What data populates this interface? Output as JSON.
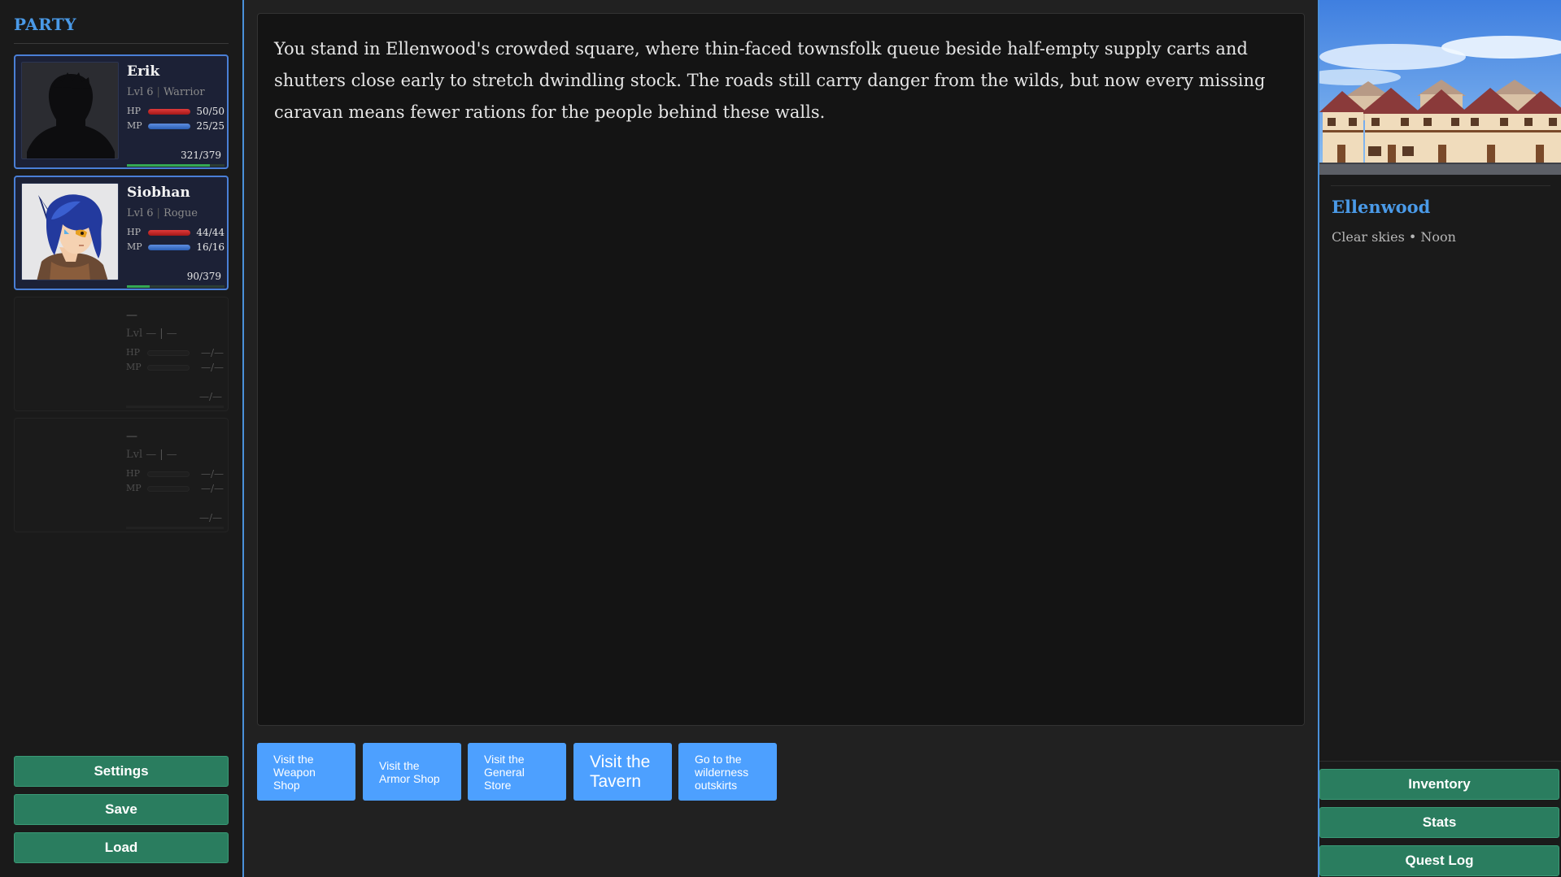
{
  "party": {
    "title": "PARTY",
    "members": [
      {
        "name": "Erik",
        "level": "Lvl 6",
        "class": "Warrior",
        "hp_label": "HP",
        "hp": "50/50",
        "hp_frac": 1.0,
        "mp_label": "MP",
        "mp": "25/25",
        "mp_frac": 1.0,
        "xp": "321/379",
        "xp_frac": 0.847
      },
      {
        "name": "Siobhan",
        "level": "Lvl 6",
        "class": "Rogue",
        "hp_label": "HP",
        "hp": "44/44",
        "hp_frac": 1.0,
        "mp_label": "MP",
        "mp": "16/16",
        "mp_frac": 1.0,
        "xp": "90/379",
        "xp_frac": 0.237
      },
      {
        "name": "—",
        "level": "Lvl —",
        "class": "—",
        "hp_label": "HP",
        "hp": "—/—",
        "hp_frac": 0,
        "mp_label": "MP",
        "mp": "—/—",
        "mp_frac": 0,
        "xp": "—/—",
        "xp_frac": 0
      },
      {
        "name": "—",
        "level": "Lvl —",
        "class": "—",
        "hp_label": "HP",
        "hp": "—/—",
        "hp_frac": 0,
        "mp_label": "MP",
        "mp": "—/—",
        "mp_frac": 0,
        "xp": "—/—",
        "xp_frac": 0
      }
    ]
  },
  "left_buttons": {
    "settings": "Settings",
    "save": "Save",
    "load": "Load"
  },
  "story": {
    "text": "You stand in Ellenwood's crowded square, where thin-faced townsfolk queue beside half-empty supply carts and shutters close early to stretch dwindling stock. The roads still carry danger from the wilds, but now every missing caravan means fewer rations for the people behind these walls."
  },
  "choices": [
    "Visit the Weapon Shop",
    "Visit the Armor Shop",
    "Visit the General Store",
    "Visit the Tavern",
    "Go to the wilderness outskirts"
  ],
  "location": {
    "name": "Ellenwood",
    "weather": "Clear skies • Noon"
  },
  "right_buttons": {
    "inventory": "Inventory",
    "stats": "Stats",
    "quest_log": "Quest Log"
  },
  "colors": {
    "accent_blue": "#4a9ae8",
    "button_green": "#2a7d5f",
    "choice_blue": "#4da0ff",
    "hp_red": "#d02a2a",
    "mp_blue": "#3d72cf",
    "xp_green": "#34a853"
  }
}
